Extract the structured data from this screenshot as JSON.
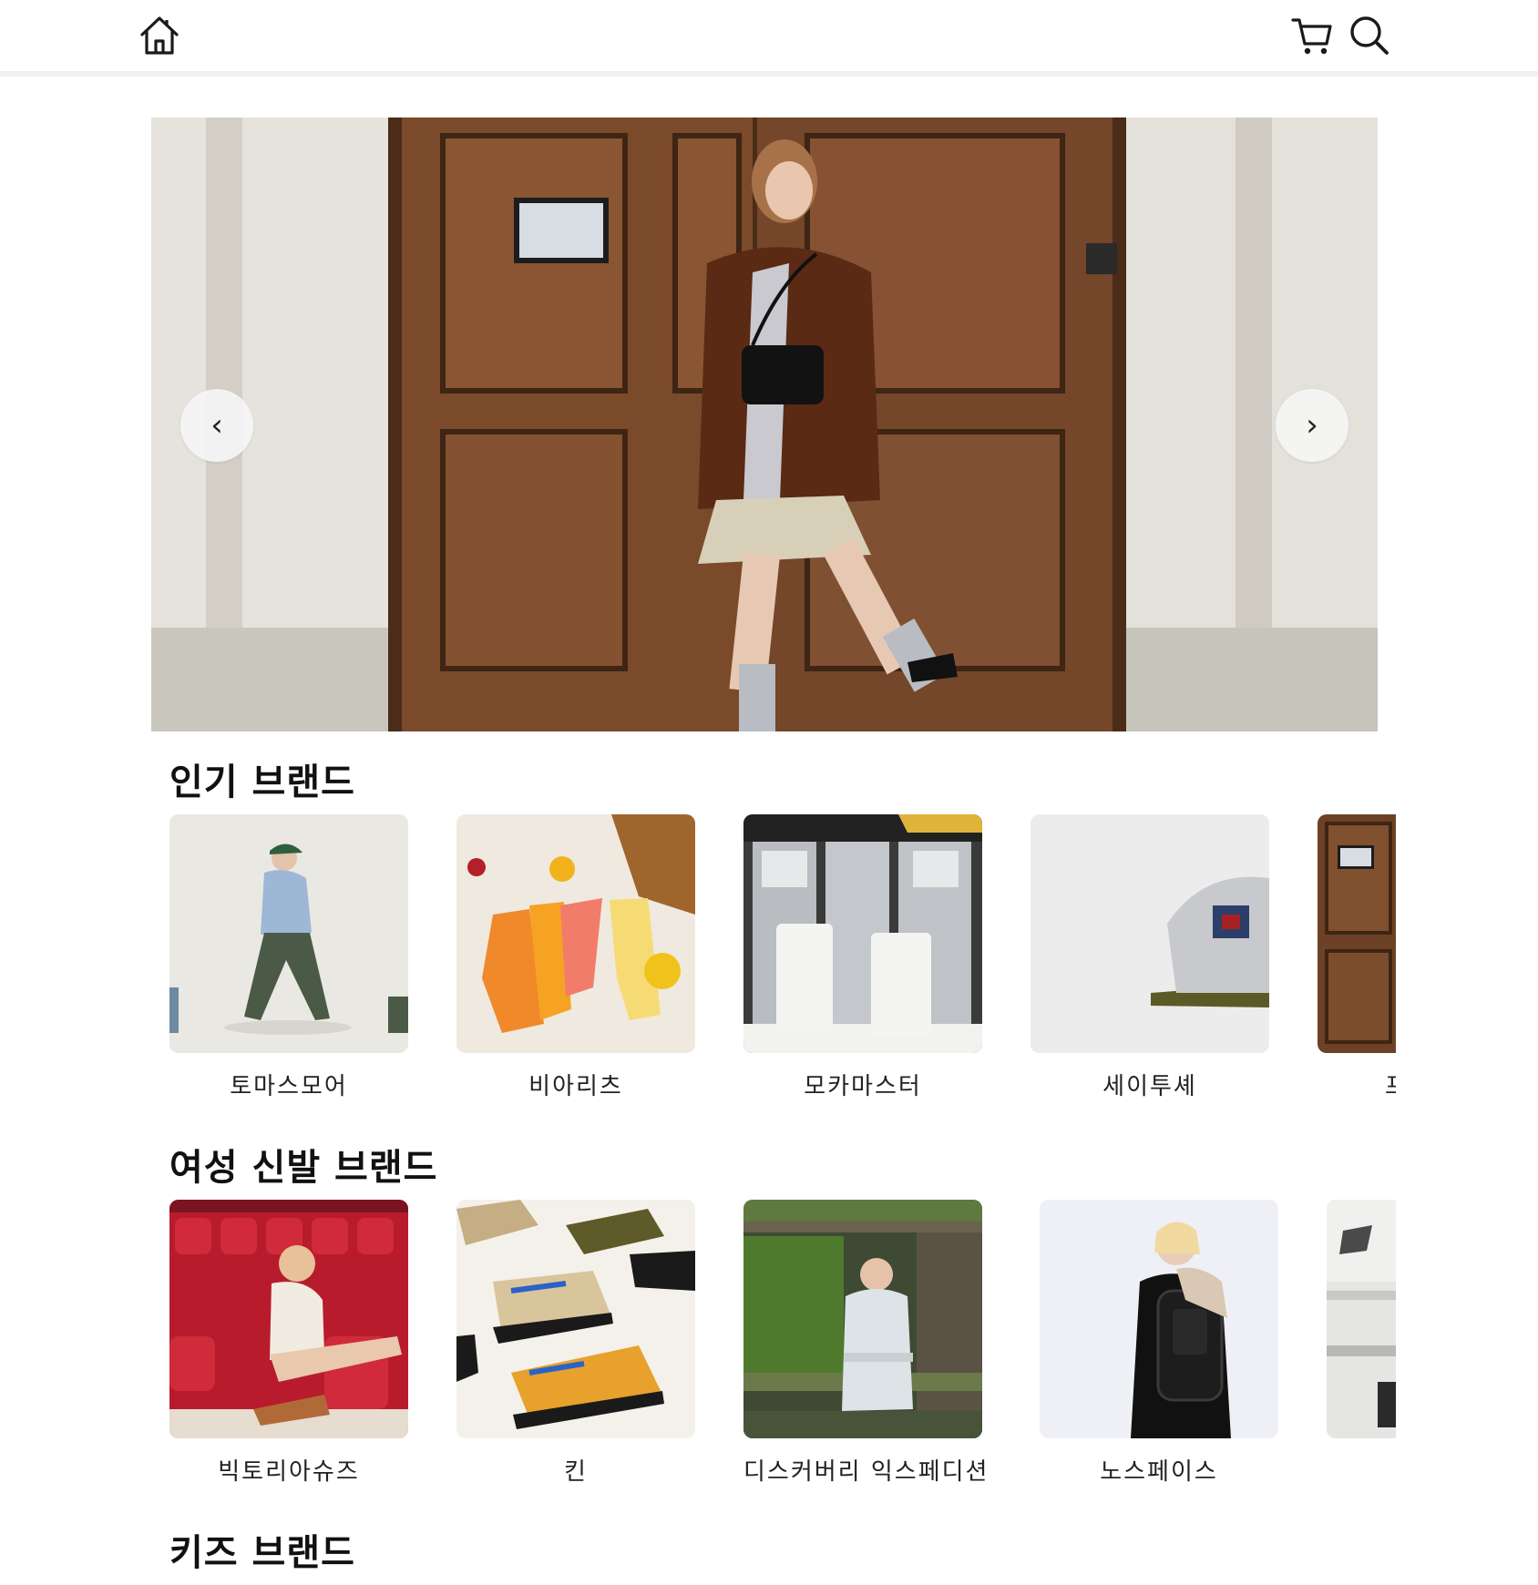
{
  "header": {
    "home_icon": "home-icon",
    "cart_icon": "cart-icon",
    "search_icon": "search-icon"
  },
  "hero": {
    "prev_label": "‹",
    "next_label": "›"
  },
  "sections": [
    {
      "title": "인기 브랜드",
      "brands": [
        {
          "name": "토마스모어"
        },
        {
          "name": "비아리츠"
        },
        {
          "name": "모카마스터"
        },
        {
          "name": "세이투셰"
        },
        {
          "name": "프"
        }
      ]
    },
    {
      "title": "여성 신발 브랜드",
      "brands": [
        {
          "name": "빅토리아슈즈"
        },
        {
          "name": "킨"
        },
        {
          "name": "디스커버리 익스페디션"
        },
        {
          "name": "노스페이스"
        },
        {
          "name": ""
        }
      ]
    },
    {
      "title": "키즈 브랜드",
      "brands": []
    }
  ]
}
